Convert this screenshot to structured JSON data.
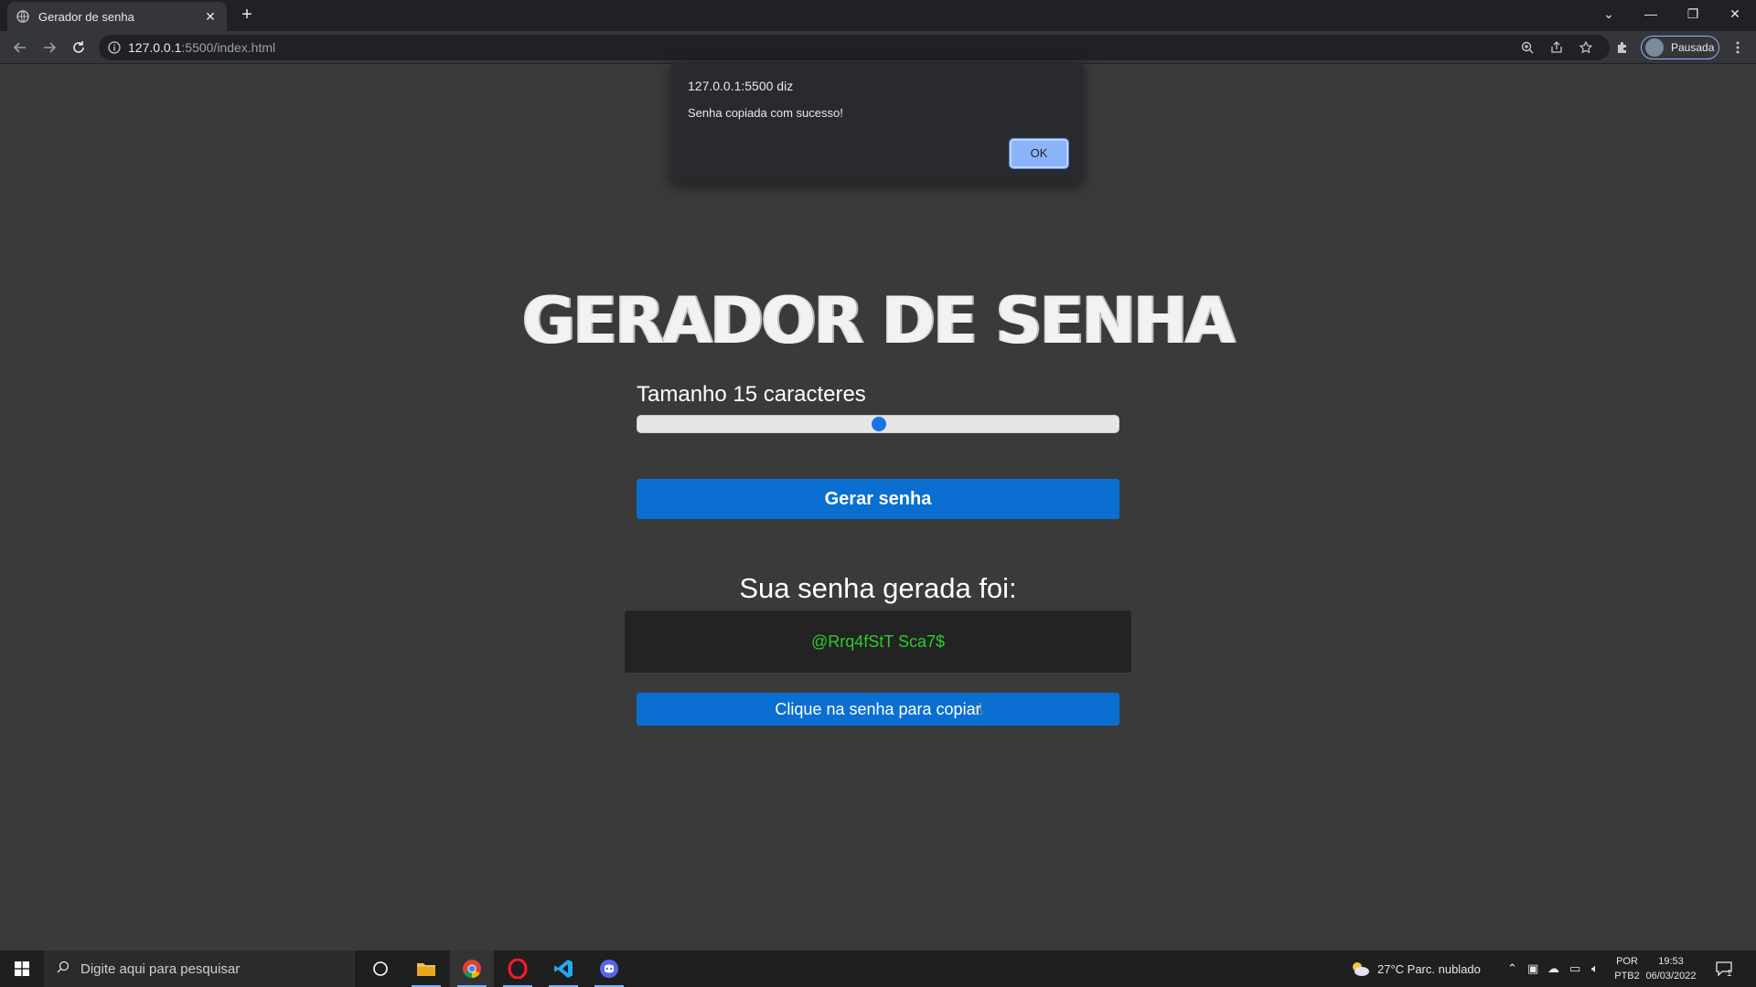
{
  "browser": {
    "tab_title": "Gerador de senha",
    "url_host": "127.0.0.1",
    "url_path": ":5500/index.html",
    "profile_label": "Pausada"
  },
  "alert": {
    "origin": "127.0.0.1:5500 diz",
    "message": "Senha copiada com sucesso!",
    "ok_label": "OK"
  },
  "app": {
    "title": "GERADOR DE SENHA",
    "size_label": "Tamanho 15 caracteres",
    "slider_fraction": 0.5,
    "generate_label": "Gerar senha",
    "result_label": "Sua senha gerada foi:",
    "password": "@Rrq4fStT Sca7$",
    "copy_label": "Clique na senha para copiar",
    "accent_color": "#0a6fd1",
    "password_color": "#2fc92f"
  },
  "taskbar": {
    "search_placeholder": "Digite aqui para pesquisar",
    "weather": "27°C  Parc. nublado",
    "lang_line1": "POR",
    "lang_line2": "PTB2",
    "time": "19:53",
    "date": "06/03/2022",
    "notification_count": "1",
    "apps": [
      "task-view-icon",
      "file-explorer-icon",
      "chrome-icon",
      "opera-icon",
      "vscode-icon",
      "discord-icon"
    ]
  }
}
